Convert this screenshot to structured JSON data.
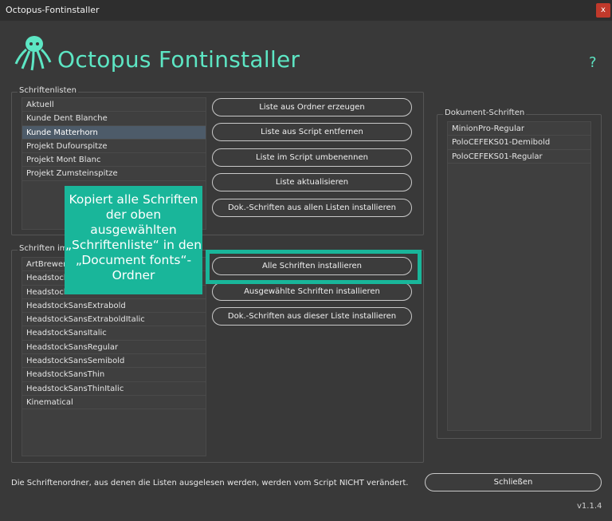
{
  "window": {
    "title": "Octopus-Fontinstaller",
    "close_label": "x"
  },
  "header": {
    "app_title": "Octopus Fontinstaller",
    "help_label": "?"
  },
  "colors": {
    "accent": "#5de6c4",
    "highlight": "#19b69a",
    "selected_row": "#4d5b69",
    "close": "#c0392b"
  },
  "lists_panel": {
    "label": "Schriftenlisten",
    "items": [
      {
        "label": "Aktuell",
        "selected": false
      },
      {
        "label": "Kunde Dent Blanche",
        "selected": false
      },
      {
        "label": "Kunde Matterhorn",
        "selected": true
      },
      {
        "label": "Projekt Dufourspitze",
        "selected": false
      },
      {
        "label": "Projekt Mont Blanc",
        "selected": false
      },
      {
        "label": "Projekt Zumsteinspitze",
        "selected": false
      }
    ]
  },
  "fonts_panel": {
    "label": "Schriften im",
    "items": [
      "ArtBrewery",
      "Headstock",
      "Headstock",
      "HeadstockSansExtrabold",
      "HeadstockSansExtraboldItalic",
      "HeadstockSansItalic",
      "HeadstockSansRegular",
      "HeadstockSansSemibold",
      "HeadstockSansThin",
      "HeadstockSansThinItalic",
      "Kinematical"
    ]
  },
  "doc_fonts_panel": {
    "label": "Dokument-Schriften",
    "items": [
      "MinionPro-Regular",
      "PoloCEFEKS01-Demibold",
      "PoloCEFEKS01-Regular"
    ]
  },
  "buttons": {
    "list_from_folder": "Liste aus Ordner erzeugen",
    "remove_list": "Liste aus Script entfernen",
    "rename_list": "Liste im Script umbenennen",
    "update_list": "Liste aktualisieren",
    "install_doc_fonts_all": "Dok.-Schriften aus allen Listen installieren",
    "install_all": "Alle Schriften installieren",
    "install_selected": "Ausgewählte Schriften installieren",
    "install_doc_fonts_this": "Dok.-Schriften aus dieser Liste installieren",
    "close": "Schließen"
  },
  "tooltip": {
    "text": "Kopiert alle Schriften der oben ausgewählten „Schriftenliste“ in den „Document fonts“-Ordner"
  },
  "footer": {
    "note": "Die Schriftenordner, aus denen die Listen ausgelesen werden, werden vom Script NICHT verändert.",
    "version": "v1.1.4"
  }
}
